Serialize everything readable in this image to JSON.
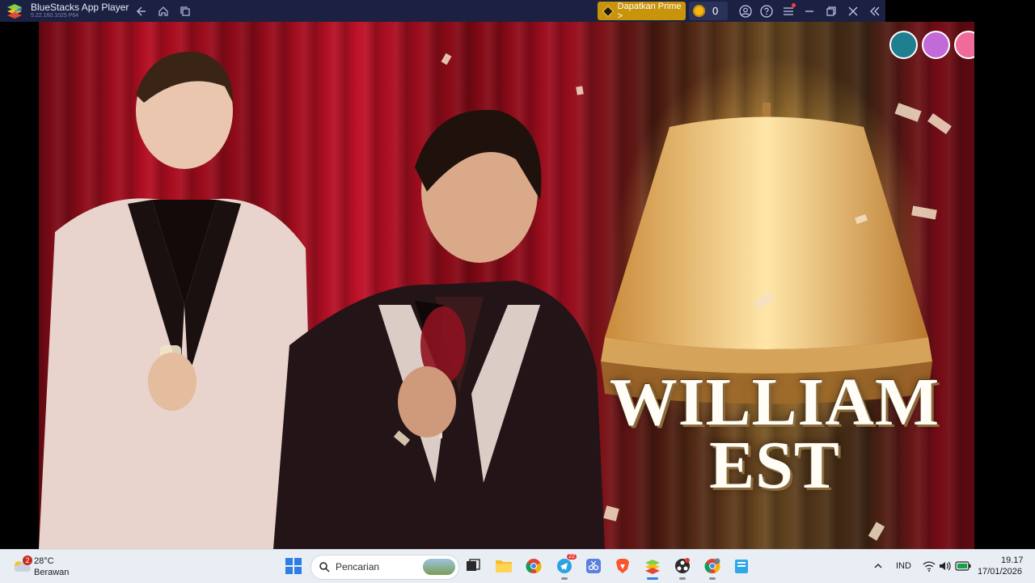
{
  "window": {
    "title": "BlueStacks App Player",
    "version": "5.22.160.1025  P64"
  },
  "toolbar": {
    "prime_label": "Dapatkan Prime >",
    "coin_count": "0",
    "icons": [
      "back-icon",
      "home-icon",
      "multi-instance-icon",
      "account-icon",
      "help-icon",
      "menu-icon",
      "minimize-icon",
      "restore-icon",
      "close-icon",
      "collapse-sidebar-icon"
    ]
  },
  "video": {
    "title_line1": "WILLIAM",
    "title_line2": "EST"
  },
  "taskbar": {
    "weather_temp": "28°C",
    "weather_desc": "Berawan",
    "weather_badge": "2",
    "search_placeholder": "Pencarian",
    "telegram_badge": "22",
    "language": "IND",
    "time": "19.17",
    "date": "17/01/2026",
    "apps": [
      "start-icon",
      "search-icon",
      "task-view-icon",
      "file-explorer-icon",
      "chrome-icon",
      "telegram-icon",
      "snipping-icon",
      "brave-icon",
      "bluestacks-icon",
      "obs-icon",
      "chrome-profile-icon",
      "notepad-icon"
    ]
  },
  "colors": {
    "titlebar_bg": "#1c2142",
    "prime_accent": "#c8940c",
    "taskbar_bg": "#e9eef5"
  }
}
